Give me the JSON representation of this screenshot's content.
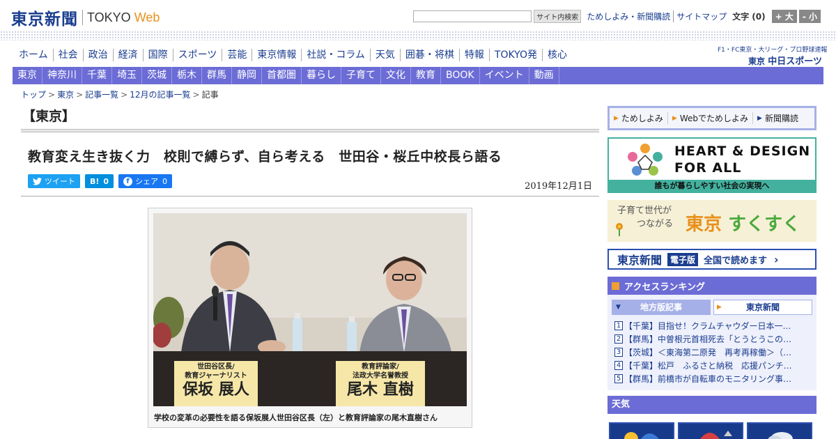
{
  "header": {
    "logo_jp": "東京新聞",
    "logo_en": "TOKYO",
    "logo_web": "Web",
    "search_button": "サイト内検索",
    "links": [
      "ためしよみ・新聞購読",
      "サイトマップ"
    ],
    "font_label": "文字",
    "font_count": "(0)",
    "font_up": "+ 大",
    "font_down": "- 小"
  },
  "main_nav": [
    "ホーム",
    "社会",
    "政治",
    "経済",
    "国際",
    "スポーツ",
    "芸能",
    "東京情報",
    "社説・コラム",
    "天気",
    "囲碁・将棋",
    "特報",
    "TOKYO発",
    "核心"
  ],
  "chunichi_banner": {
    "small": "F1・FC東京・大リーグ・プロ野球速報",
    "big_prefix": "東京",
    "big_name": "中日スポーツ"
  },
  "sub_nav": [
    "東京",
    "神奈川",
    "千葉",
    "埼玉",
    "茨城",
    "栃木",
    "群馬",
    "静岡",
    "首都圏",
    "暮らし",
    "子育て",
    "文化",
    "教育",
    "BOOK",
    "イベント",
    "動画"
  ],
  "breadcrumb": [
    "トップ",
    "東京",
    "記事一覧",
    "12月の記事一覧",
    "記事"
  ],
  "breadcrumb_sep": ">",
  "article": {
    "section": "【東京】",
    "headline": "教育変え生き抜く力　校則で縛らず、自ら考える　世田谷・桜丘中校長ら語る",
    "date": "2019年12月1日",
    "share": {
      "tweet": "ツイート",
      "hatena": "B!",
      "hatena_count": "0",
      "facebook": "シェア",
      "facebook_count": "0"
    },
    "photo_placard_left": [
      "世田谷区長/",
      "教育ジャーナリスト",
      "保坂 展人"
    ],
    "photo_placard_right": [
      "教育評論家/",
      "法政大学名誉教授",
      "尾木 直樹"
    ],
    "caption": "学校の変革の必要性を語る保坂展人世田谷区長（左）と教育評論家の尾木直樹さん"
  },
  "sidebar": {
    "tabs": [
      "ためしよみ",
      "Webでためしよみ",
      "新聞購読"
    ],
    "heart_design": {
      "line1": "HEART & DESIGN",
      "line2": "FOR ALL",
      "footer": "誰もが暮らしやすい社会の実現へ"
    },
    "sukusuku": {
      "sub1": "子育て世代が",
      "sub2": "つながる",
      "big1": "東京",
      "big2": "すくすく"
    },
    "e_edition": {
      "logo": "東京新聞",
      "tag": "電子版",
      "text": "全国で読めます"
    },
    "ranking": {
      "title": "アクセスランキング",
      "tab_local": "地方版記事",
      "tab_tokyo": "東京新聞",
      "items": [
        {
          "num": "1",
          "text": "【千葉】目指せ！クラムチャウダー日本一…"
        },
        {
          "num": "2",
          "text": "【群馬】中曽根元首相死去「とうとうこの…"
        },
        {
          "num": "3",
          "text": "【茨城】＜東海第二原発　再考再稼働＞（…"
        },
        {
          "num": "4",
          "text": "【千葉】松戸　ふるさと納税　応援パンチ…"
        },
        {
          "num": "5",
          "text": "【群馬】前橋市が自転車のモニタリング事…"
        }
      ]
    },
    "weather_title": "天気"
  },
  "colors": {
    "brand_blue": "#1a3d8f",
    "nav_purple": "#6c6cd6",
    "accent_orange": "#e8901c",
    "hd_green": "#43b19e"
  }
}
